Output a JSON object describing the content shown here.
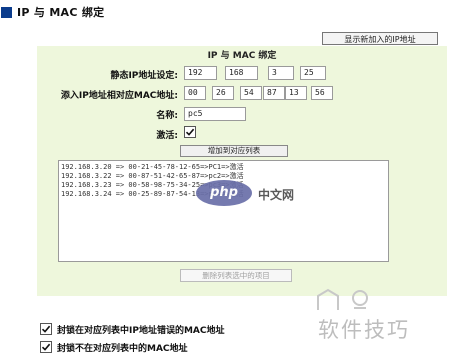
{
  "header": {
    "title": "IP 与 MAC 绑定"
  },
  "show_new_ip_button": "显示新加入的IP地址",
  "panel": {
    "title": "IP 与  MAC 绑定",
    "static_ip_label": "静态IP地址设定:",
    "static_ip": [
      "192",
      "168",
      "3",
      "25"
    ],
    "mac_label": "添入IP地址相对应MAC地址:",
    "mac": [
      "00",
      "26",
      "54",
      "87",
      "13",
      "56"
    ],
    "name_label": "名称:",
    "name_value": "pc5",
    "activate_label": "激活:",
    "activate_checked": true,
    "add_button": "增加到对应列表",
    "list_items": [
      "192.168.3.20 => 00-21-45-78-12-65=>PC1=>激活",
      "192.168.3.22 => 00-87-51-42-65-87=>pc2=>激活",
      "192.168.3.23 => 00-58-98-75-34-25=>pc3=>激活",
      "192.168.3.24 => 00-25-89-87-54-13=>pc4=>激活"
    ],
    "delete_button": "删除列表选中的项目"
  },
  "options": [
    {
      "label": "封锁在对应列表中IP地址错误的MAC地址",
      "checked": true
    },
    {
      "label": "封锁不在对应列表中的MAC地址",
      "checked": true
    }
  ],
  "watermark": {
    "logo": "php",
    "logo_cn": "中文网",
    "brand": "软件技巧"
  },
  "colors": {
    "panel_bg": "#eef7dc",
    "title_square": "#0b3c8c",
    "logo_bg": "#6a6fa9"
  }
}
